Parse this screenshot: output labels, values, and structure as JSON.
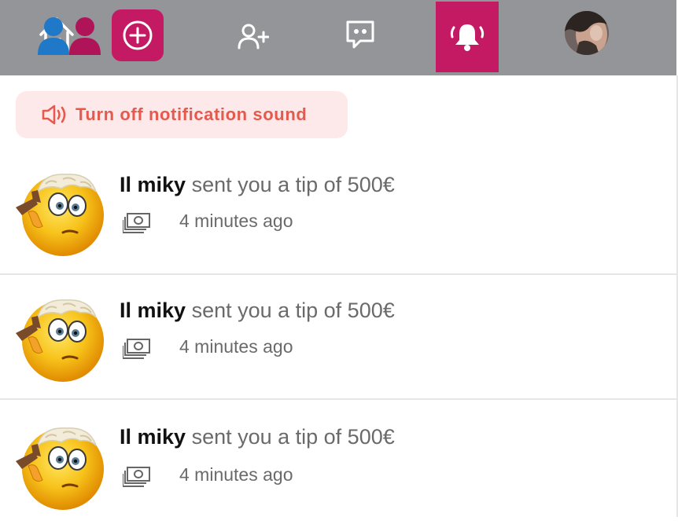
{
  "nav": {
    "items": [
      "home-icon",
      "add-icon",
      "add-friend-icon",
      "messages-icon",
      "notifications-icon",
      "profile-avatar"
    ],
    "active": "notifications",
    "bg_color": "#939598",
    "accent_color": "#c41a64"
  },
  "sound_toggle": {
    "label": "Turn off notification sound",
    "icon": "speaker-icon",
    "color": "#e55a4e",
    "bg": "#fde9e9"
  },
  "notifications": [
    {
      "user": "Il miky",
      "text": "sent you a tip of 500€",
      "time": "4 minutes ago",
      "icon": "money-icon"
    },
    {
      "user": "Il miky",
      "text": "sent you a tip of 500€",
      "time": "4 minutes ago",
      "icon": "money-icon"
    },
    {
      "user": "Il miky",
      "text": "sent you a tip of 500€",
      "time": "4 minutes ago",
      "icon": "money-icon"
    }
  ]
}
